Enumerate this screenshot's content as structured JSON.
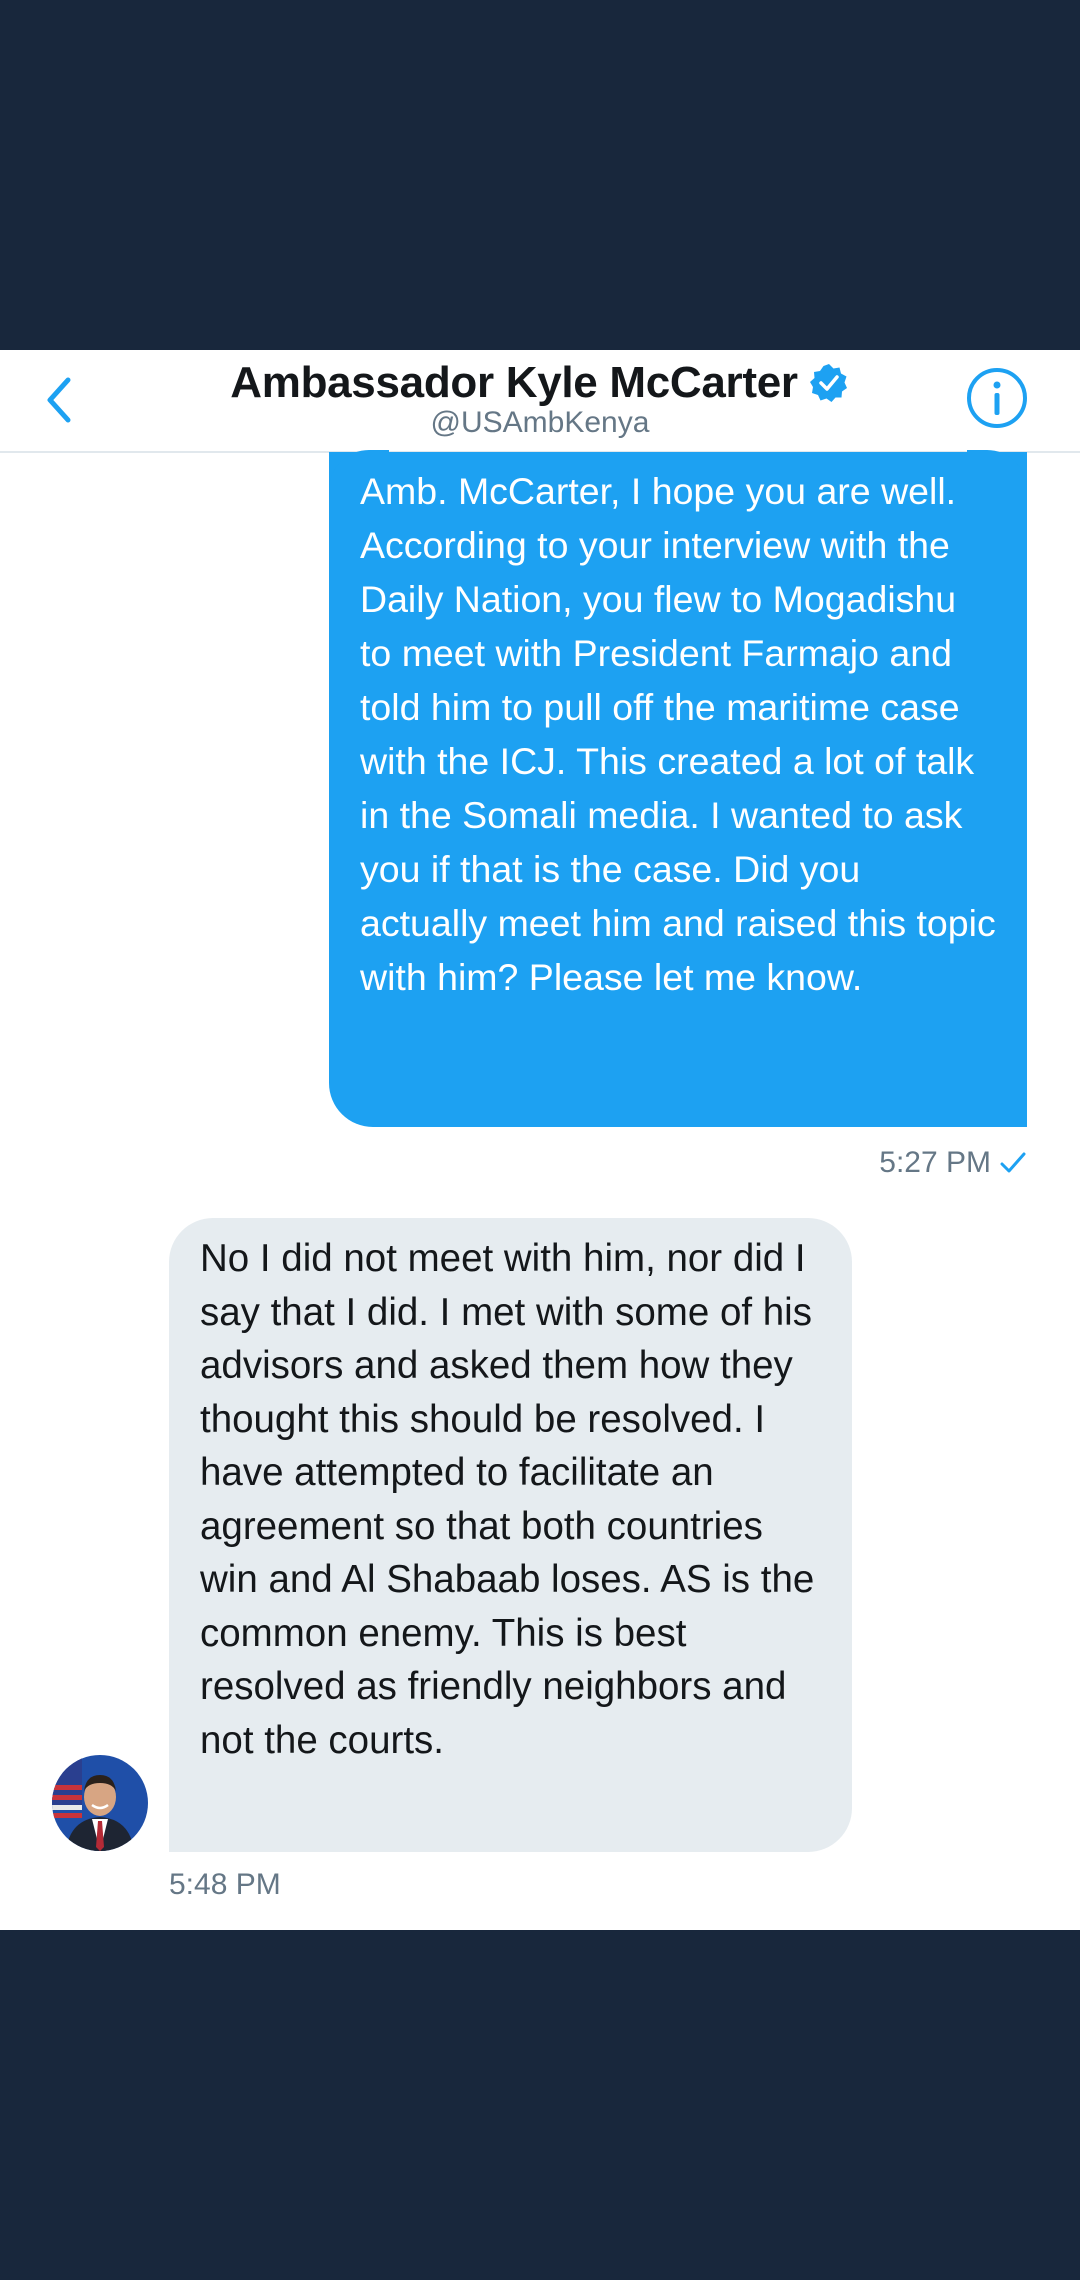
{
  "header": {
    "title": "Ambassador Kyle McCarter",
    "handle": "@USAmbKenya",
    "back_icon": "chevron-left-icon",
    "verified_icon": "verified-badge-icon",
    "info_icon": "info-icon",
    "accent_color": "#1da1f2"
  },
  "messages": [
    {
      "direction": "outgoing",
      "text": "Amb. McCarter, I hope you are well. According to your interview with the Daily Nation, you flew to Mogadishu to meet with President Farmajo and told him to pull off the maritime case with the ICJ. This created a lot of talk in the Somali media. I wanted to ask you if that is the case. Did you actually meet him and raised this topic with him? Please let me know.",
      "time": "5:27 PM",
      "status_icon": "checkmark-icon"
    },
    {
      "direction": "incoming",
      "text": "No I did not meet with him, nor did I say that I did. I met with some of his advisors and asked them how they thought this should be resolved. I have attempted to facilitate an agreement so that both countries win and Al Shabaab loses. AS is the common enemy. This is best resolved as friendly neighbors and not the courts.",
      "time": "5:48 PM",
      "avatar_icon": "avatar-photo"
    }
  ],
  "colors": {
    "outer_background": "#18273c",
    "outgoing_bubble": "#1da1f2",
    "incoming_bubble": "#e6ecf0",
    "secondary_text": "#657786"
  }
}
